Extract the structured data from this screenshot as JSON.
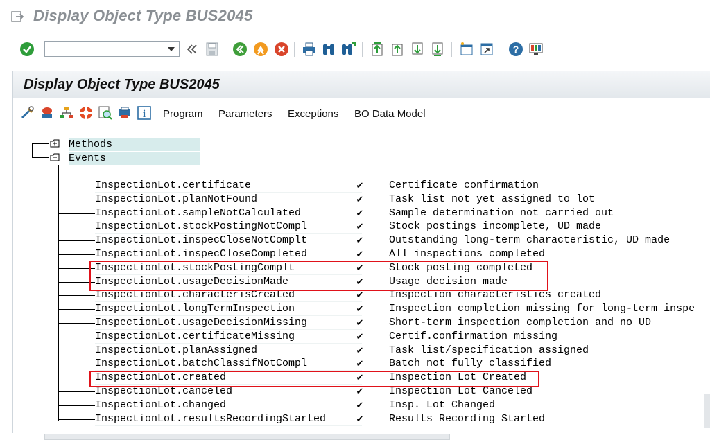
{
  "window": {
    "title": "Display Object Type BUS2045"
  },
  "toolbar": {
    "command_field": "",
    "buttons": [
      "enter-icon",
      "dropdown-icon",
      "back-chevrons-icon",
      "save-icon",
      "back-icon",
      "exit-icon",
      "cancel-icon",
      "print-icon",
      "find-icon",
      "find-next-icon",
      "first-page-icon",
      "previous-page-icon",
      "next-page-icon",
      "last-page-icon",
      "create-session-icon",
      "shortcut-icon",
      "help-icon",
      "customize-layout-icon"
    ]
  },
  "panel": {
    "title": "Display Object Type BUS2045",
    "menu": [
      "Program",
      "Parameters",
      "Exceptions",
      "BO Data Model"
    ]
  },
  "tree": {
    "methods_label": "Methods",
    "events_label": "Events",
    "events": [
      {
        "name": "InspectionLot.certificate",
        "check": "✔",
        "desc": "Certificate confirmation"
      },
      {
        "name": "InspectionLot.planNotFound",
        "check": "✔",
        "desc": "Task list not yet assigned to lot"
      },
      {
        "name": "InspectionLot.sampleNotCalculated",
        "check": "✔",
        "desc": "Sample determination not carried out"
      },
      {
        "name": "InspectionLot.stockPostingNotCompl",
        "check": "✔",
        "desc": "Stock postings incomplete, UD made"
      },
      {
        "name": "InspectionLot.inspecCloseNotComplt",
        "check": "✔",
        "desc": "Outstanding long-term characteristic, UD made"
      },
      {
        "name": "InspectionLot.inspecCloseCompleted",
        "check": "✔",
        "desc": "All inspections completed"
      },
      {
        "name": "InspectionLot.stockPostingComplt",
        "check": "✔",
        "desc": "Stock posting completed"
      },
      {
        "name": "InspectionLot.usageDecisionMade",
        "check": "✔",
        "desc": "Usage decision made"
      },
      {
        "name": "InspectionLot.characterisCreated",
        "check": "✔",
        "desc": "Inspection characteristics created"
      },
      {
        "name": "InspectionLot.longTermInspection",
        "check": "✔",
        "desc": "Inspection completion missing for long-term inspe"
      },
      {
        "name": "InspectionLot.usageDecisionMissing",
        "check": "✔",
        "desc": "Short-term inspection completion and no UD"
      },
      {
        "name": "InspectionLot.certificateMissing",
        "check": "✔",
        "desc": "Certif.confirmation missing"
      },
      {
        "name": "InspectionLot.planAssigned",
        "check": "✔",
        "desc": "Task list/specification assigned"
      },
      {
        "name": "InspectionLot.batchClassifNotCompl",
        "check": "✔",
        "desc": "Batch not fully classified"
      },
      {
        "name": "InspectionLot.created",
        "check": "✔",
        "desc": "Inspection Lot Created"
      },
      {
        "name": "InspectionLot.canceled",
        "check": "✔",
        "desc": "Inspection Lot Canceled"
      },
      {
        "name": "InspectionLot.changed",
        "check": "✔",
        "desc": "Insp. Lot Changed"
      },
      {
        "name": "InspectionLot.resultsRecordingStarted",
        "check": "✔",
        "desc": "Results Recording Started"
      }
    ]
  },
  "colors": {
    "highlight": "#e0121a",
    "node_bg": "#d7ecec",
    "title_grey": "#8a8f94"
  }
}
